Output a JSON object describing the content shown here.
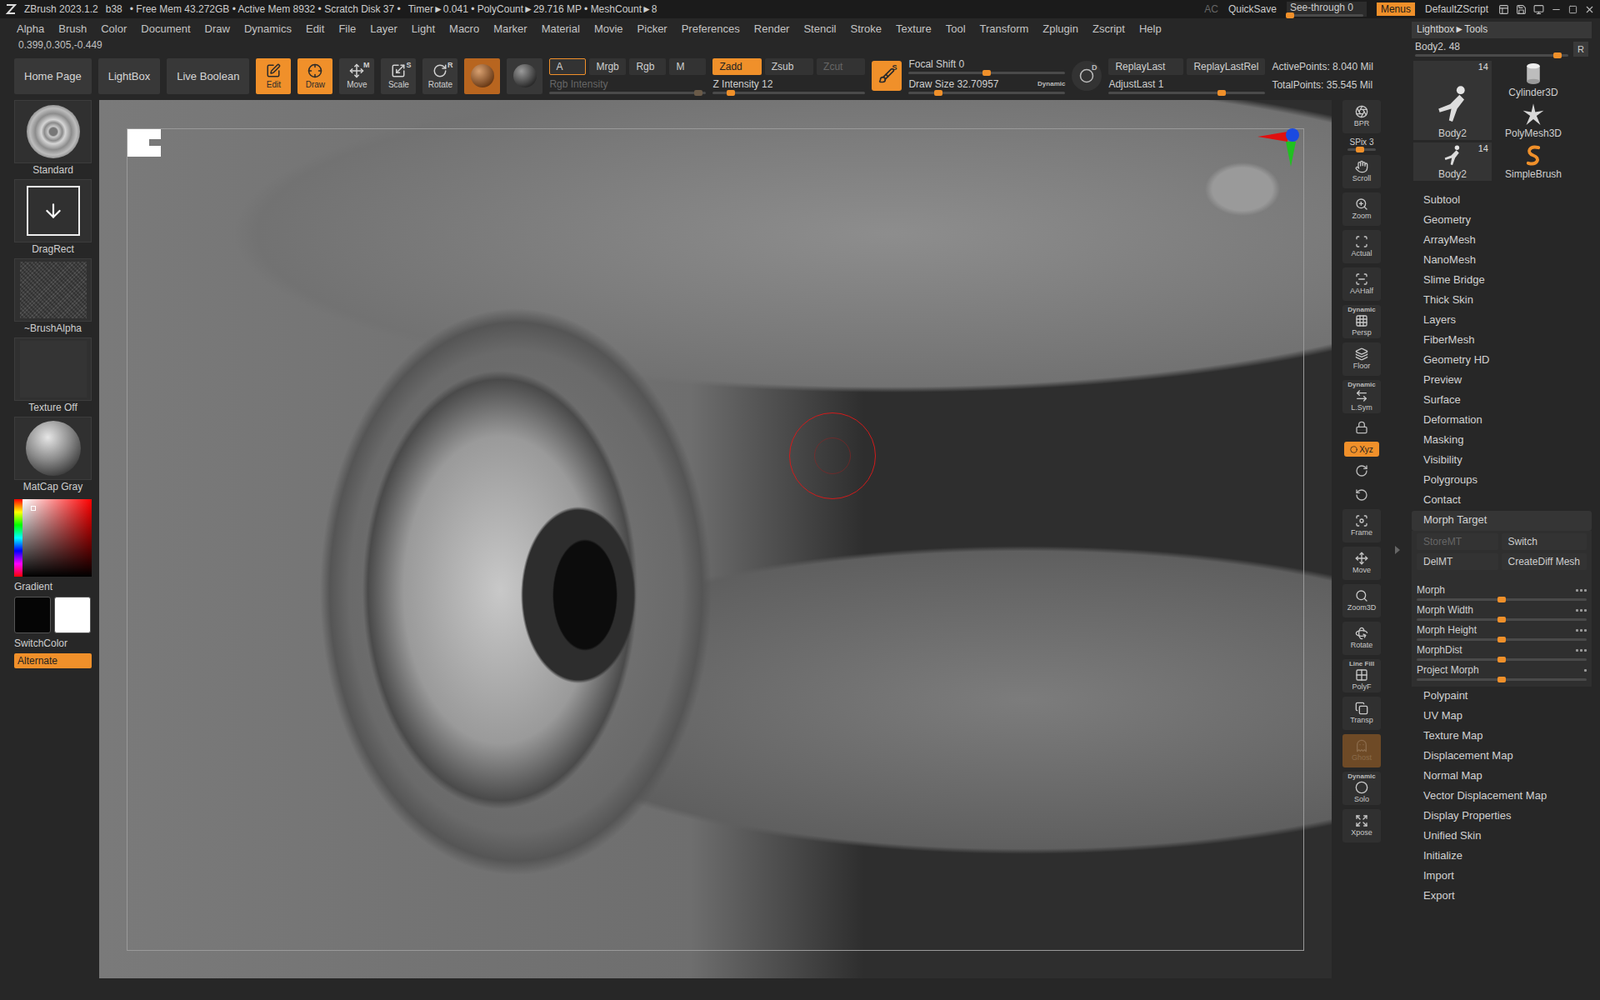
{
  "title_bar": {
    "app": "ZBrush 2023.1.2",
    "build": "b38",
    "memory": "• Free Mem 43.272GB • Active Mem 8932 • Scratch Disk 37 •",
    "stats": "Timer►0.041 • PolyCount►29.716 MP • MeshCount►8",
    "ac": {
      "label": "AC",
      "disabled": true
    },
    "quicksave": "QuickSave",
    "see_through": {
      "label": "See-through",
      "value": "0",
      "level": 0
    },
    "menus": {
      "label": "Menus",
      "selected": true
    },
    "script": "DefaultZScript"
  },
  "menu_bar": [
    "Alpha",
    "Brush",
    "Color",
    "Document",
    "Draw",
    "Dynamics",
    "Edit",
    "File",
    "Layer",
    "Light",
    "Macro",
    "Marker",
    "Material",
    "Movie",
    "Picker",
    "Preferences",
    "Render",
    "Stencil",
    "Stroke",
    "Texture",
    "Tool",
    "Transform",
    "Zplugin",
    "Zscript",
    "Help"
  ],
  "coordinates": "0.399,0.305,-0.449",
  "toolbar": {
    "nav_buttons": [
      "Home Page",
      "LightBox",
      "Live Boolean"
    ],
    "modes": [
      {
        "label": "Edit",
        "key": "",
        "selected": true
      },
      {
        "label": "Draw",
        "key": "",
        "selected": true
      },
      {
        "label": "Move",
        "key": "M",
        "selected": false
      },
      {
        "label": "Scale",
        "key": "S",
        "selected": false
      },
      {
        "label": "Rotate",
        "key": "R",
        "selected": false
      }
    ],
    "materials": [
      {
        "selected": true
      },
      {
        "selected": false
      }
    ],
    "channels": [
      {
        "label": "A",
        "selected": true
      },
      {
        "label": "Mrgb",
        "selected": false
      },
      {
        "label": "Rgb",
        "selected": false
      },
      {
        "label": "M",
        "selected": false
      }
    ],
    "rgb_intensity": {
      "label": "Rgb Intensity",
      "disabled": true,
      "level": 0.95
    },
    "z_modes": [
      {
        "label": "Zadd",
        "selected": true,
        "disabled": false
      },
      {
        "label": "Zsub",
        "selected": false,
        "disabled": false
      },
      {
        "label": "Zcut",
        "selected": false,
        "disabled": true
      }
    ],
    "z_intensity": {
      "label": "Z Intensity",
      "value": "12",
      "level": 0.12
    },
    "sculpt_key": "S",
    "focal_shift": {
      "label": "Focal Shift",
      "value": "0",
      "level": 0.5
    },
    "draw_size": {
      "label": "Draw Size",
      "value": "32.70957",
      "level": 0.19,
      "badge": "Dynamic"
    },
    "dynamic_key": "D",
    "replay": [
      "ReplayLast",
      "ReplayLastRel"
    ],
    "adjust_last": {
      "label": "AdjustLast",
      "value": "1",
      "level": 0.72
    },
    "stats": [
      "ActivePoints: 8.040 Mil",
      "TotalPoints: 35.545 Mil"
    ]
  },
  "left_panel": {
    "tiles": [
      {
        "label": "Standard",
        "kind": "brush"
      },
      {
        "label": "DragRect",
        "kind": "stroke"
      },
      {
        "label": "~BrushAlpha",
        "kind": "alpha"
      },
      {
        "label": "Texture Off",
        "kind": "texture"
      },
      {
        "label": "MatCap Gray",
        "kind": "material"
      }
    ],
    "gradient_label": "Gradient",
    "swatches": [
      {
        "color": "#050505"
      },
      {
        "color": "#ffffff"
      }
    ],
    "switch_color": "SwitchColor",
    "alternate": {
      "label": "Alternate",
      "selected": true
    }
  },
  "shelf": [
    {
      "kind": "button",
      "label": "BPR",
      "selected": false
    },
    {
      "kind": "slider",
      "label": "SPix 3",
      "level": 0.45
    },
    {
      "kind": "button",
      "label": "Scroll",
      "selected": false
    },
    {
      "kind": "button",
      "label": "Zoom",
      "selected": false
    },
    {
      "kind": "button",
      "label": "Actual",
      "selected": false
    },
    {
      "kind": "button",
      "label": "AAHalf",
      "selected": false
    },
    {
      "kind": "button",
      "top": "Dynamic",
      "label": "Persp",
      "selected": false
    },
    {
      "kind": "button",
      "label": "Floor",
      "selected": false
    },
    {
      "kind": "button",
      "top": "Dynamic",
      "label": "L.Sym",
      "selected": false
    },
    {
      "kind": "icon",
      "selected": false
    },
    {
      "kind": "toggle",
      "label": "Xyz",
      "selected": true
    },
    {
      "kind": "icon",
      "selected": false
    },
    {
      "kind": "icon",
      "selected": false
    },
    {
      "kind": "button",
      "label": "Frame",
      "selected": false
    },
    {
      "kind": "button",
      "label": "Move",
      "selected": false
    },
    {
      "kind": "button",
      "label": "Zoom3D",
      "selected": false
    },
    {
      "kind": "button",
      "label": "Rotate",
      "selected": false
    },
    {
      "kind": "button",
      "top": "Line Fill",
      "label": "PolyF",
      "selected": false
    },
    {
      "kind": "button",
      "label": "Transp",
      "selected": false
    },
    {
      "kind": "button",
      "label": "Ghost",
      "selected": true,
      "disabled": true
    },
    {
      "kind": "button",
      "top": "Dynamic",
      "label": "Solo",
      "selected": false
    },
    {
      "kind": "button",
      "label": "Xpose",
      "selected": false
    }
  ],
  "tray": {
    "header": "Lightbox►Tools",
    "current": {
      "label": "Body2. 48",
      "level": 0.93,
      "button": "R"
    },
    "tools": [
      {
        "label": "Body2",
        "count": "14",
        "kind": "figure",
        "size": "large"
      },
      {
        "label": "Cylinder3D",
        "count": "",
        "kind": "cylinder",
        "size": "small"
      },
      {
        "label": "PolyMesh3D",
        "count": "",
        "kind": "star",
        "size": "small"
      },
      {
        "label": "Body2",
        "count": "14",
        "kind": "figure",
        "size": "small"
      },
      {
        "label": "SimpleBrush",
        "count": "",
        "kind": "brush",
        "size": "small"
      }
    ],
    "menu": [
      {
        "label": "Subtool",
        "expanded": false
      },
      {
        "label": "Geometry",
        "expanded": false
      },
      {
        "label": "ArrayMesh",
        "expanded": false
      },
      {
        "label": "NanoMesh",
        "expanded": false
      },
      {
        "label": "Slime Bridge",
        "expanded": false
      },
      {
        "label": "Thick Skin",
        "expanded": false
      },
      {
        "label": "Layers",
        "expanded": false
      },
      {
        "label": "FiberMesh",
        "expanded": false
      },
      {
        "label": "Geometry HD",
        "expanded": false
      },
      {
        "label": "Preview",
        "expanded": false
      },
      {
        "label": "Surface",
        "expanded": false
      },
      {
        "label": "Deformation",
        "expanded": false
      },
      {
        "label": "Masking",
        "expanded": false
      },
      {
        "label": "Visibility",
        "expanded": false
      },
      {
        "label": "Polygroups",
        "expanded": false
      },
      {
        "label": "Contact",
        "expanded": false
      },
      {
        "label": "Morph Target",
        "expanded": true
      },
      {
        "label": "Polypaint",
        "expanded": false
      },
      {
        "label": "UV Map",
        "expanded": false
      },
      {
        "label": "Texture Map",
        "expanded": false
      },
      {
        "label": "Displacement Map",
        "expanded": false
      },
      {
        "label": "Normal Map",
        "expanded": false
      },
      {
        "label": "Vector Displacement Map",
        "expanded": false
      },
      {
        "label": "Display Properties",
        "expanded": false
      },
      {
        "label": "Unified Skin",
        "expanded": false
      },
      {
        "label": "Initialize",
        "expanded": false
      },
      {
        "label": "Import",
        "expanded": false
      },
      {
        "label": "Export",
        "expanded": false
      }
    ],
    "morph_target": {
      "buttons": [
        {
          "label": "StoreMT",
          "disabled": true
        },
        {
          "label": "Switch",
          "disabled": false
        },
        {
          "label": "DelMT",
          "disabled": false
        },
        {
          "label": "CreateDiff Mesh",
          "disabled": false
        }
      ],
      "sliders": [
        {
          "label": "Morph",
          "level": 0.5,
          "kind": "xyz"
        },
        {
          "label": "Morph Width",
          "level": 0.5,
          "kind": "xyz"
        },
        {
          "label": "Morph Height",
          "level": 0.5,
          "kind": "xyz"
        },
        {
          "label": "MorphDist",
          "level": 0.5,
          "kind": "xyz"
        },
        {
          "label": "Project Morph",
          "level": 0.5,
          "kind": "dot"
        }
      ]
    }
  }
}
